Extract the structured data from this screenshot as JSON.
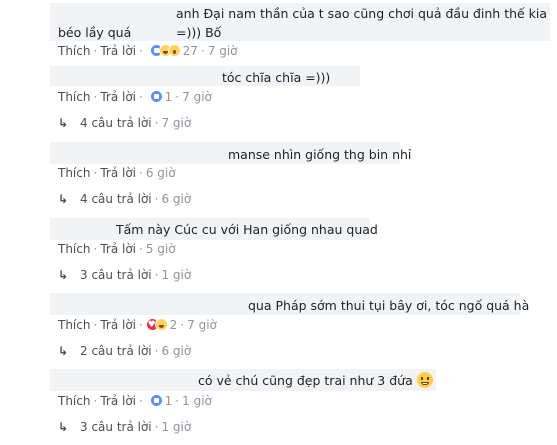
{
  "comments": [
    {
      "text_line1": "anh Đại nam thần của t sao cũng chơi quả đầu đinh thế kia =))) Bố",
      "text_line2": "béo lầy quá",
      "like_label": "Thích",
      "reply_label": "Trả lời",
      "reactions": [
        "like",
        "haha",
        "wow"
      ],
      "reaction_count": "27",
      "time": "7 giờ"
    },
    {
      "text_line1": "tóc chĩa chĩa =)))",
      "like_label": "Thích",
      "reply_label": "Trả lời",
      "reactions": [
        "like"
      ],
      "reaction_count": "1",
      "time": "7 giờ",
      "replies_label": "4 câu trả lời",
      "replies_time": "7 giờ"
    },
    {
      "text_line1": "manse nhìn giống thg bin nhỉ",
      "like_label": "Thích",
      "reply_label": "Trả lời",
      "time": "6 giờ",
      "replies_label": "4 câu trả lời",
      "replies_time": "6 giờ"
    },
    {
      "text_line1": "Tấm này Cúc cu với Han giống nhau quad",
      "like_label": "Thích",
      "reply_label": "Trả lời",
      "time": "5 giờ",
      "replies_label": "3 câu trả lời",
      "replies_time": "1 giờ"
    },
    {
      "text_line1": "qua Pháp sớm thui tụi bây ơi, tóc ngố quá hà",
      "like_label": "Thích",
      "reply_label": "Trả lời",
      "reactions": [
        "love",
        "haha"
      ],
      "reaction_count": "2",
      "time": "7 giờ",
      "replies_label": "2 câu trả lời",
      "replies_time": "6 giờ"
    },
    {
      "text_line1": "có vẻ chú cũng đẹp trai như 3 đứa",
      "emoji": "grinning-face-emoji",
      "like_label": "Thích",
      "reply_label": "Trả lời",
      "reactions": [
        "like"
      ],
      "reaction_count": "1",
      "time": "1 giờ",
      "replies_label": "3 câu trả lời",
      "replies_time": "1 giờ"
    }
  ],
  "colors": {
    "bubble": "#f2f3f5",
    "link": "#4b4f56",
    "meta": "#90949c",
    "like": "#5890ff",
    "love": "#f0284a",
    "haha": "#ffd35a"
  }
}
